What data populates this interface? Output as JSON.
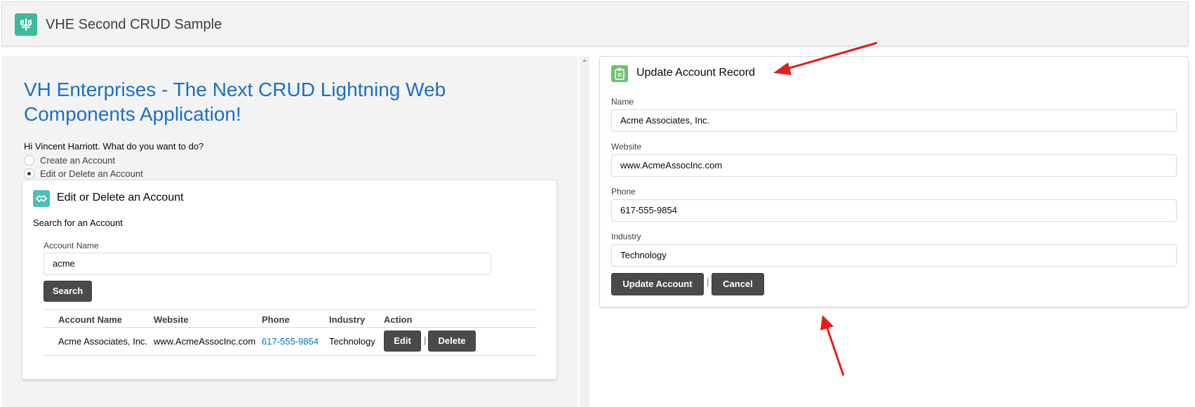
{
  "app": {
    "title": "VHE Second CRUD Sample",
    "logo_icon": "app-logo-icon"
  },
  "main": {
    "heading_line1": "VH Enterprises - The Next CRUD Lightning Web",
    "heading_line2": "Components Application!",
    "greeting": "Hi Vincent Harriott. What do you want to do?",
    "options": [
      {
        "label": "Create an Account",
        "selected": false
      },
      {
        "label": "Edit or Delete an Account",
        "selected": true
      }
    ]
  },
  "edit_card": {
    "title": "Edit or Delete an Account",
    "search_prompt": "Search for an Account",
    "account_name_label": "Account Name",
    "account_name_value": "acme",
    "search_button": "Search",
    "table": {
      "columns": [
        "Account Name",
        "Website",
        "Phone",
        "Industry",
        "Action"
      ],
      "rows": [
        {
          "account_name": "Acme Associates, Inc.",
          "website": "www.AcmeAssocInc.com",
          "phone": "617-555-9854",
          "industry": "Technology",
          "edit_label": "Edit",
          "separator": "|",
          "delete_label": "Delete"
        }
      ]
    }
  },
  "update_card": {
    "title": "Update Account Record",
    "fields": {
      "name_label": "Name",
      "name_value": "Acme Associates, Inc.",
      "website_label": "Website",
      "website_value": "www.AcmeAssocInc.com",
      "phone_label": "Phone",
      "phone_value": "617-555-9854",
      "industry_label": "Industry",
      "industry_value": "Technology"
    },
    "update_button": "Update Account",
    "separator": "|",
    "cancel_button": "Cancel"
  },
  "colors": {
    "heading_blue": "#1b6fc4",
    "link_blue": "#0070d2",
    "button_dark": "#4a4a4a",
    "annotation_red": "#e51c1c"
  }
}
